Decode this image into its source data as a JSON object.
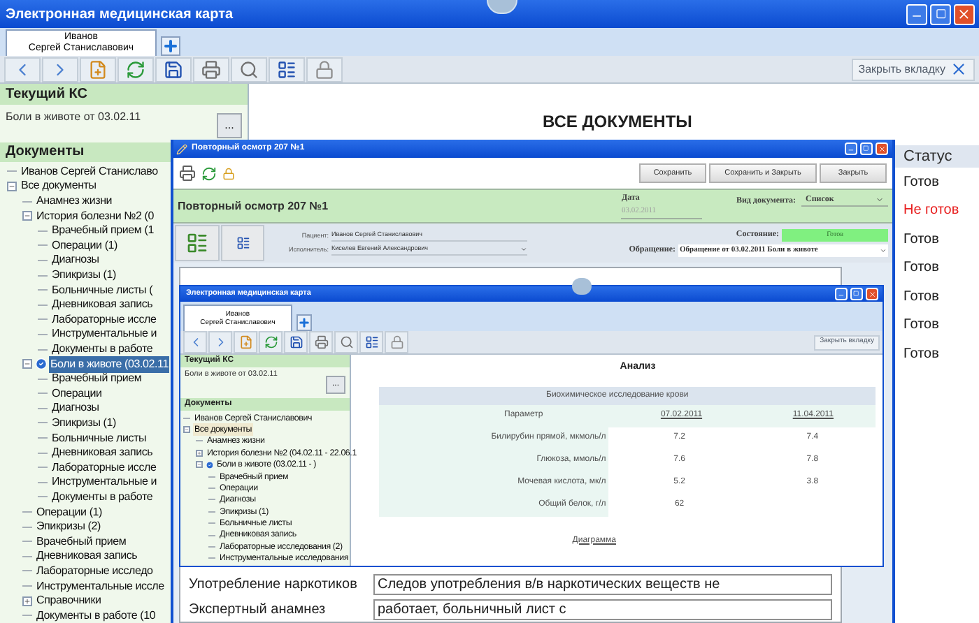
{
  "main_window": {
    "title": "Электронная медицинская карта",
    "patient_tab": {
      "lines": [
        "Иванов",
        "Сергей Станиславович"
      ],
      "selected": true
    },
    "close_tab": "Закрыть вкладку",
    "current_case": {
      "heading": "Текущий КС",
      "value": "Боли в животе от 03.02.11",
      "button": "..."
    },
    "documents": {
      "heading": "Документы",
      "tree": [
        {
          "label": "Иванов Сергей Станиславо",
          "kind": "item",
          "selected": false
        },
        {
          "label": "Все документы",
          "kind": "item",
          "selected": false,
          "expanded": true,
          "children": [
            {
              "label": "Анамнез жизни",
              "kind": "item",
              "selected": false
            },
            {
              "label": "История болезни №2 (0",
              "kind": "item",
              "selected": false,
              "expanded": true,
              "children": [
                {
                  "label": "Врачебный прием (1",
                  "kind": "item",
                  "selected": false
                },
                {
                  "label": "Операции (1)",
                  "kind": "item",
                  "selected": false
                },
                {
                  "label": "Диагнозы",
                  "kind": "item",
                  "selected": false
                },
                {
                  "label": "Эпикризы (1)",
                  "kind": "item",
                  "selected": false
                },
                {
                  "label": "Больничные листы (",
                  "kind": "item",
                  "selected": false
                },
                {
                  "label": "Дневниковая запись",
                  "kind": "item",
                  "selected": false
                },
                {
                  "label": "Лабораторные иссле",
                  "kind": "item",
                  "selected": false
                },
                {
                  "label": "Инструментальные и",
                  "kind": "item",
                  "selected": false
                },
                {
                  "label": "Документы в работе",
                  "kind": "item",
                  "selected": false
                }
              ]
            },
            {
              "label": "Боли в животе (03.02.11",
              "kind": "case",
              "selected": true,
              "expanded": true,
              "children": [
                {
                  "label": "Врачебный прием",
                  "kind": "item",
                  "selected": false
                },
                {
                  "label": "Операции",
                  "kind": "item",
                  "selected": false
                },
                {
                  "label": "Диагнозы",
                  "kind": "item",
                  "selected": false
                },
                {
                  "label": "Эпикризы (1)",
                  "kind": "item",
                  "selected": false
                },
                {
                  "label": "Больничные листы",
                  "kind": "item",
                  "selected": false
                },
                {
                  "label": "Дневниковая запись",
                  "kind": "item",
                  "selected": false
                },
                {
                  "label": "Лабораторные иссле",
                  "kind": "item",
                  "selected": false
                },
                {
                  "label": "Инструментальные и",
                  "kind": "item",
                  "selected": false
                },
                {
                  "label": "Документы в работе",
                  "kind": "item",
                  "selected": false
                }
              ]
            },
            {
              "label": "Операции (1)",
              "kind": "item",
              "selected": false
            },
            {
              "label": "Эпикризы (2)",
              "kind": "item",
              "selected": false
            },
            {
              "label": "Врачебный прием",
              "kind": "item",
              "selected": false
            },
            {
              "label": "Дневниковая запись",
              "kind": "item",
              "selected": false
            },
            {
              "label": "Лабораторные исследо",
              "kind": "item",
              "selected": false
            },
            {
              "label": "Инструментальные иссле",
              "kind": "item",
              "selected": false
            },
            {
              "label": "Справочники",
              "kind": "item",
              "selected": false,
              "expanded": false
            },
            {
              "label": "Документы в работе (10",
              "kind": "item",
              "selected": false
            }
          ]
        }
      ]
    },
    "page_title": "ВСЕ ДОКУМЕНТЫ",
    "status_column": {
      "header": "Статус",
      "rows": [
        {
          "text": "Готов",
          "ready": true
        },
        {
          "text": "Не готов",
          "ready": false
        },
        {
          "text": "Готов",
          "ready": true
        },
        {
          "text": "Готов",
          "ready": true
        },
        {
          "text": "Готов",
          "ready": true
        },
        {
          "text": "Готов",
          "ready": true
        },
        {
          "text": "Готов",
          "ready": true
        }
      ]
    }
  },
  "dialog": {
    "title": "Повторный осмотр 207 №1",
    "buttons": [
      "Сохранить",
      "Сохранить и Закрыть",
      "Закрыть"
    ],
    "heading": "Повторный осмотр 207 №1",
    "date": {
      "label": "Дата",
      "value": "03.02.2011"
    },
    "doc_type": {
      "label": "Вид документа:",
      "value": "Список"
    },
    "patient": {
      "label": "Пациент:",
      "value": "Иванов Сергей Станиславович"
    },
    "executor": {
      "label": "Исполнитель:",
      "value": "Киселев Евгений Александрович"
    },
    "state": {
      "label": "Состояние:",
      "value": "Готов"
    },
    "visit": {
      "label": "Обращение:",
      "value": "Обращение от 03.02.2011 Боли в животе"
    },
    "fields": [
      {
        "label": "Употребление наркотиков",
        "value": "Следов употребления в/в наркотических веществ не"
      },
      {
        "label": "Экспертный анамнез",
        "value": "работает, больничный лист с"
      }
    ]
  },
  "inner_window": {
    "title": "Электронная медицинская карта",
    "patient_tab": {
      "lines": [
        "Иванов",
        "Сергей Станиславович"
      ],
      "selected": true
    },
    "close_tab": "Закрыть вкладку",
    "current_case": {
      "heading": "Текущий КС",
      "value": "Боли в животе от 03.02.11",
      "button": "..."
    },
    "documents": {
      "heading": "Документы",
      "tree": [
        {
          "label": "Иванов Сергей Станиславович",
          "kind": "item",
          "selected": false
        },
        {
          "label": "Все документы",
          "kind": "item",
          "selected": true,
          "expanded": true,
          "children": [
            {
              "label": "Анамнез жизни",
              "kind": "item",
              "selected": false
            },
            {
              "label": "История болезни №2 (04.02.11 - 22.06.1",
              "kind": "item",
              "selected": false,
              "expanded": false
            },
            {
              "label": "Боли в животе (03.02.11 - )",
              "kind": "case",
              "selected": false,
              "expanded": true,
              "children": [
                {
                  "label": "Врачебный прием",
                  "kind": "item",
                  "selected": false
                },
                {
                  "label": "Операции",
                  "kind": "item",
                  "selected": false
                },
                {
                  "label": "Диагнозы",
                  "kind": "item",
                  "selected": false
                },
                {
                  "label": "Эпикризы (1)",
                  "kind": "item",
                  "selected": false
                },
                {
                  "label": "Больничные листы",
                  "kind": "item",
                  "selected": false
                },
                {
                  "label": "Дневниковая запись",
                  "kind": "item",
                  "selected": false
                },
                {
                  "label": "Лабораторные исследования (2)",
                  "kind": "item",
                  "selected": false
                },
                {
                  "label": "Инструментальные исследования",
                  "kind": "item",
                  "selected": false
                }
              ]
            }
          ]
        }
      ]
    },
    "analysis": {
      "title": "Анализ",
      "caption": "Биохимическое исследование крови",
      "columns": [
        "Параметр",
        "07.02.2011",
        "11.04.2011"
      ],
      "rows": [
        [
          "Билирубин прямой, мкмоль/л",
          "7.2",
          "7.4"
        ],
        [
          "Глюкоза, ммоль/л",
          "7.6",
          "7.8"
        ],
        [
          "Мочевая кислота, мк/л",
          "5.2",
          "3.8"
        ],
        [
          "Общий белок, г/л",
          "62",
          ""
        ]
      ],
      "link": "Диаграмма"
    }
  }
}
